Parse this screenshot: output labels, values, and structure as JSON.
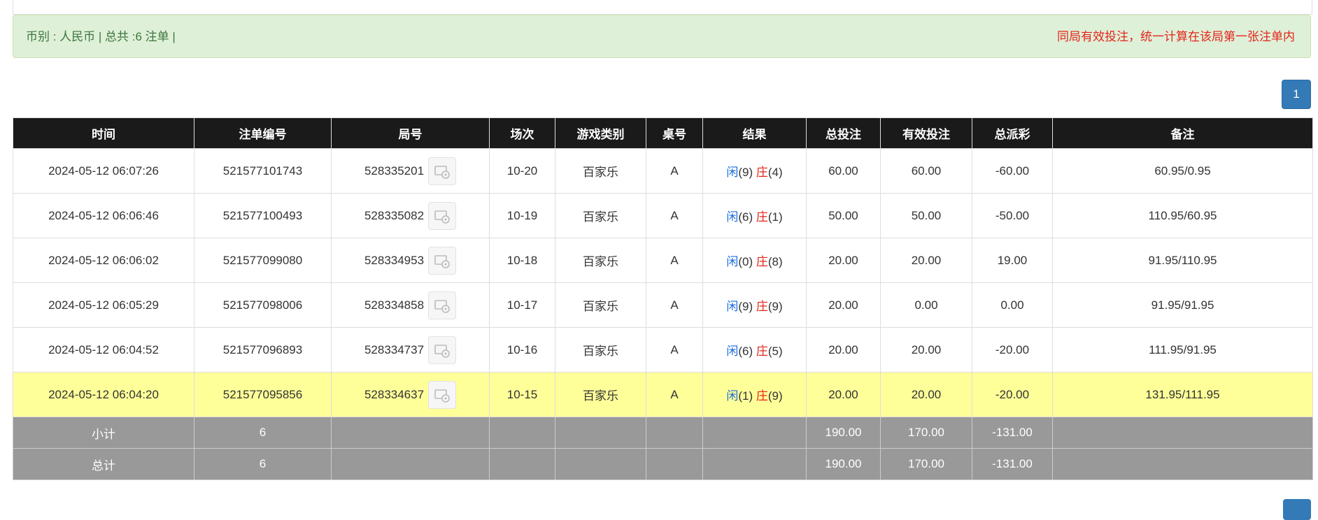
{
  "summary": {
    "left_text": "币别 : 人民币 | 总共 :6 注单 |",
    "right_notice": "同局有效投注，统一计算在该局第一张注单内"
  },
  "pagination": {
    "current_page": "1"
  },
  "table": {
    "headers": [
      "时间",
      "注单编号",
      "局号",
      "场次",
      "游戏类别",
      "桌号",
      "结果",
      "总投注",
      "有效投注",
      "总派彩",
      "备注"
    ],
    "rows": [
      {
        "time": "2024-05-12 06:07:26",
        "bet_no": "521577101743",
        "round": "528335201",
        "session": "10-20",
        "game": "百家乐",
        "table": "A",
        "player_label": "闲",
        "player_score": "(9)",
        "banker_label": "庄",
        "banker_score": "(4)",
        "total_bet": "60.00",
        "valid_bet": "60.00",
        "payout": "-60.00",
        "remark": "60.95/0.95"
      },
      {
        "time": "2024-05-12 06:06:46",
        "bet_no": "521577100493",
        "round": "528335082",
        "session": "10-19",
        "game": "百家乐",
        "table": "A",
        "player_label": "闲",
        "player_score": "(6)",
        "banker_label": "庄",
        "banker_score": "(1)",
        "total_bet": "50.00",
        "valid_bet": "50.00",
        "payout": "-50.00",
        "remark": "110.95/60.95"
      },
      {
        "time": "2024-05-12 06:06:02",
        "bet_no": "521577099080",
        "round": "528334953",
        "session": "10-18",
        "game": "百家乐",
        "table": "A",
        "player_label": "闲",
        "player_score": "(0)",
        "banker_label": "庄",
        "banker_score": "(8)",
        "total_bet": "20.00",
        "valid_bet": "20.00",
        "payout": "19.00",
        "remark": "91.95/110.95"
      },
      {
        "time": "2024-05-12 06:05:29",
        "bet_no": "521577098006",
        "round": "528334858",
        "session": "10-17",
        "game": "百家乐",
        "table": "A",
        "player_label": "闲",
        "player_score": "(9)",
        "banker_label": "庄",
        "banker_score": "(9)",
        "total_bet": "20.00",
        "valid_bet": "0.00",
        "payout": "0.00",
        "remark": "91.95/91.95"
      },
      {
        "time": "2024-05-12 06:04:52",
        "bet_no": "521577096893",
        "round": "528334737",
        "session": "10-16",
        "game": "百家乐",
        "table": "A",
        "player_label": "闲",
        "player_score": "(6)",
        "banker_label": "庄",
        "banker_score": "(5)",
        "total_bet": "20.00",
        "valid_bet": "20.00",
        "payout": "-20.00",
        "remark": "111.95/91.95"
      },
      {
        "time": "2024-05-12 06:04:20",
        "bet_no": "521577095856",
        "round": "528334637",
        "session": "10-15",
        "game": "百家乐",
        "table": "A",
        "player_label": "闲",
        "player_score": "(1)",
        "banker_label": "庄",
        "banker_score": "(9)",
        "total_bet": "20.00",
        "valid_bet": "20.00",
        "payout": "-20.00",
        "remark": "131.95/111.95"
      }
    ],
    "subtotal": {
      "label": "小计",
      "count": "6",
      "total_bet": "190.00",
      "valid_bet": "170.00",
      "payout": "-131.00"
    },
    "total": {
      "label": "总计",
      "count": "6",
      "total_bet": "190.00",
      "valid_bet": "170.00",
      "payout": "-131.00"
    }
  },
  "colors": {
    "header_bg": "#1a1a1a",
    "info_bg": "#dff0d8",
    "highlight_row": "#ffff99",
    "player_blue": "#1a6de0",
    "banker_red": "#e4251b",
    "pager_blue": "#337ab7"
  }
}
